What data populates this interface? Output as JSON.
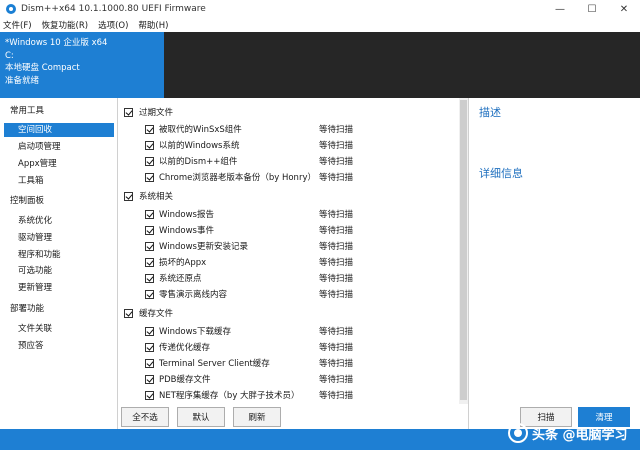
{
  "window": {
    "title": "Dism++x64 10.1.1000.80 UEFI Firmware",
    "minimize": "—",
    "maximize": "☐",
    "close": "✕"
  },
  "menu": [
    "文件(F)",
    "恢复功能(R)",
    "选项(O)",
    "帮助(H)"
  ],
  "header": {
    "os_name": "*Windows 10 企业版 x64",
    "drive": "C:",
    "disk": "本地硬盘 Compact",
    "status": "准备就绪"
  },
  "nav": {
    "common_tools": "常用工具",
    "space_cleanup": "空间回收",
    "startup": "启动项管理",
    "appx": "Appx管理",
    "toolbox": "工具箱",
    "control_panel": "控制面板",
    "sys_optimize": "系统优化",
    "drivers": "驱动管理",
    "programs": "程序和功能",
    "optional": "可选功能",
    "updates": "更新管理",
    "deploy": "部署功能",
    "file_assoc": "文件关联",
    "answer_file": "预应答"
  },
  "cleanup": {
    "status_text": "等待扫描",
    "groups": [
      {
        "label": "过期文件",
        "items": [
          "被取代的WinSxS组件",
          "以前的Windows系统",
          "以前的Dism++组件",
          "Chrome浏览器老版本备份（by Honry）"
        ]
      },
      {
        "label": "系统相关",
        "items": [
          "Windows报告",
          "Windows事件",
          "Windows更新安装记录",
          "损坏的Appx",
          "系统还原点",
          "零售演示离线内容"
        ]
      },
      {
        "label": "缓存文件",
        "items": [
          "Windows下载缓存",
          "传递优化缓存",
          "Terminal Server Client缓存",
          "PDB缓存文件",
          "NET程序集缓存（by 大胖子技术员）"
        ]
      }
    ]
  },
  "info": {
    "description": "描述",
    "details": "详细信息"
  },
  "buttons": {
    "deselect_all": "全不选",
    "default": "默认",
    "refresh": "刷新",
    "scan": "扫描",
    "clean": "清理"
  },
  "watermark": "头条 @电脑学习"
}
